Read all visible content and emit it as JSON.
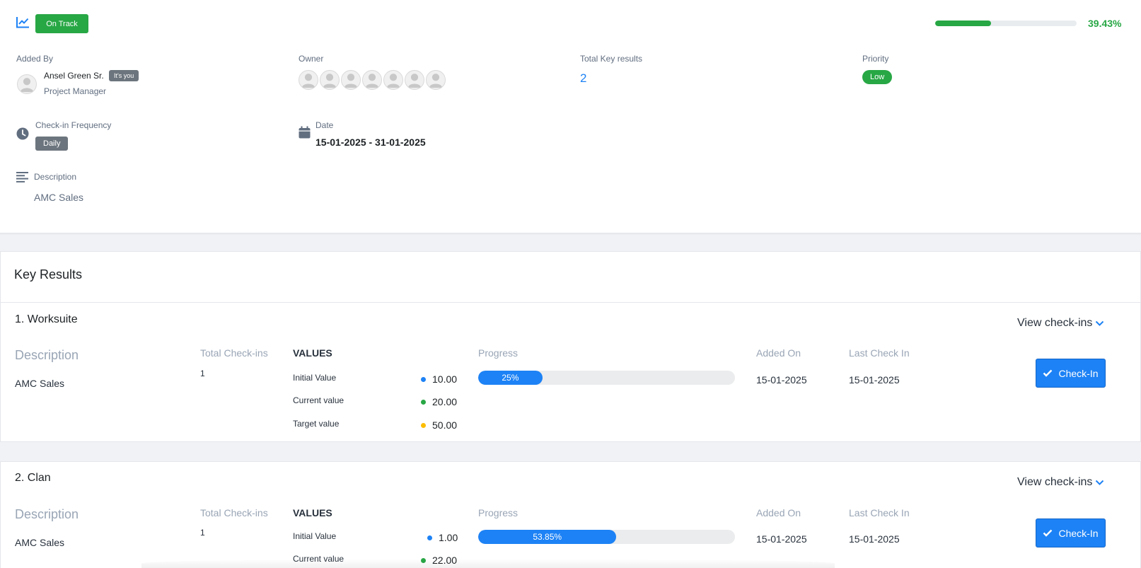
{
  "header": {
    "status": "On Track",
    "overall_progress_pct": 39.43,
    "overall_progress_label": "39.43%",
    "colors": {
      "success": "#28a745",
      "primary": "#1d82f5",
      "muted": "#6c757d"
    },
    "icons": {
      "status": "trend-chart-icon"
    }
  },
  "details": {
    "added_by_label": "Added By",
    "added_by_name": "Ansel Green Sr.",
    "added_by_tag": "It's you",
    "added_by_role": "Project Manager",
    "owner_label": "Owner",
    "owner_count": 7,
    "total_kr_label": "Total Key results",
    "total_kr_value": "2",
    "priority_label": "Priority",
    "priority_value": "Low",
    "frequency_label": "Check-in Frequency",
    "frequency_value": "Daily",
    "date_label": "Date",
    "date_value": "15-01-2025 - 31-01-2025",
    "description_label": "Description",
    "description_value": "AMC Sales"
  },
  "key_results": {
    "title": "Key Results",
    "columns": {
      "description": "Description",
      "total_checkins": "Total Check-ins",
      "values": "VALUES",
      "progress": "Progress",
      "added_on": "Added On",
      "last_checkin": "Last Check In"
    },
    "value_labels": {
      "initial": "Initial Value",
      "current": "Current value",
      "target": "Target value"
    },
    "view_checkins": "View check-ins",
    "checkin_button": "Check-In",
    "items": [
      {
        "title": "1. Worksuite",
        "description": "AMC Sales",
        "total_checkins": "1",
        "initial": "10.00",
        "current": "20.00",
        "target": "50.00",
        "progress_pct": 25,
        "progress_label": "25%",
        "added_on": "15-01-2025",
        "last_checkin": "15-01-2025"
      },
      {
        "title": "2. Clan",
        "description": "AMC Sales",
        "total_checkins": "1",
        "initial": "1.00",
        "current": "22.00",
        "progress_pct": 53.85,
        "progress_label": "53.85%",
        "added_on": "15-01-2025",
        "last_checkin": "15-01-2025"
      }
    ]
  }
}
